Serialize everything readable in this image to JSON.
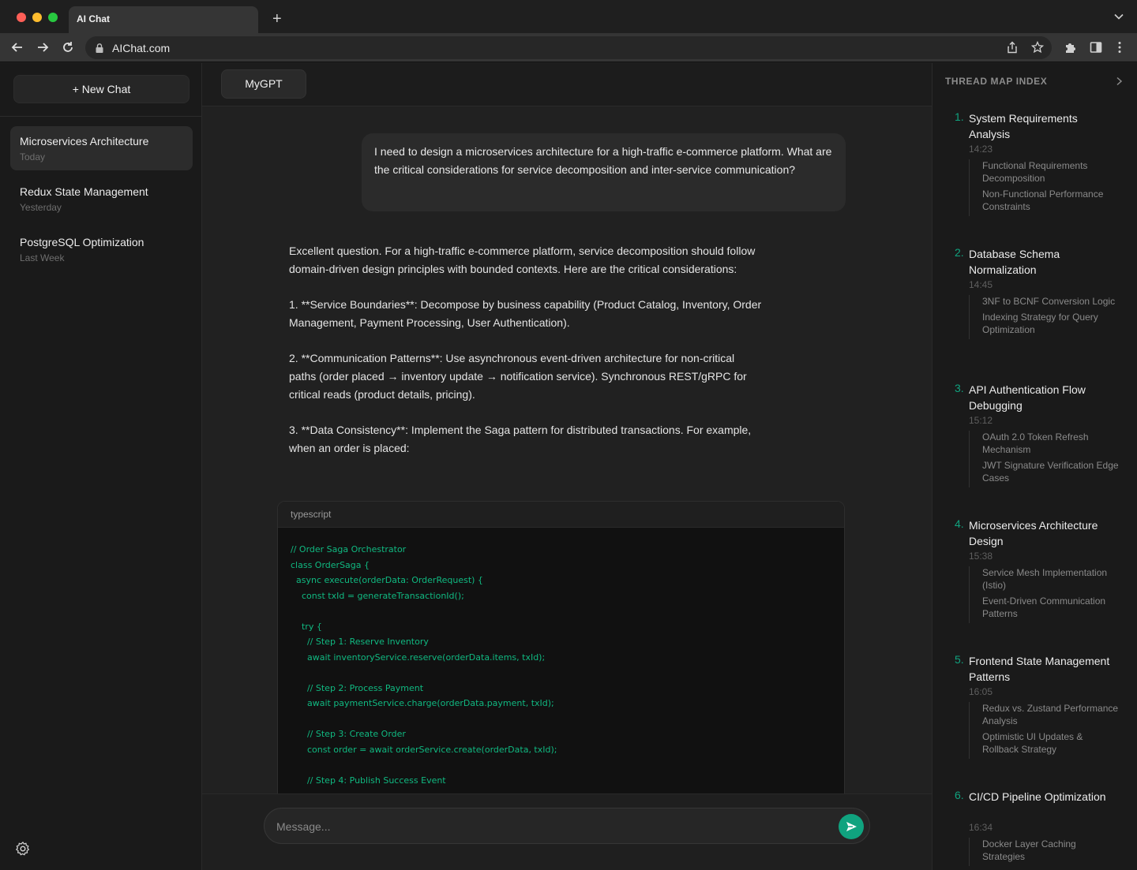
{
  "browser": {
    "tab_title": "AI Chat",
    "new_tab_label": "+",
    "url": "AIChat.com"
  },
  "sidebar": {
    "new_chat_label": "+ New Chat",
    "chats": [
      {
        "title": "Microservices Architecture",
        "date": "Today",
        "active": true
      },
      {
        "title": "Redux State Management",
        "date": "Yesterday",
        "active": false
      },
      {
        "title": "PostgreSQL Optimization",
        "date": "Last Week",
        "active": false
      }
    ]
  },
  "main": {
    "model_label": "MyGPT",
    "user_message": "I need to design a microservices architecture for a high-traffic e-commerce platform. What are the critical considerations for service decomposition and inter-service communication?",
    "assistant_paragraphs": [
      "Excellent question. For a high-traffic e-commerce platform, service decomposition should follow domain-driven design principles with bounded contexts. Here are the critical considerations:",
      "1. **Service Boundaries**: Decompose by business capability (Product Catalog, Inventory, Order Management, Payment Processing, User Authentication).",
      "2. **Communication Patterns**: Use asynchronous event-driven architecture for non-critical paths (order placed → inventory update → notification service). Synchronous REST/gRPC for critical reads (product details, pricing).",
      "3. **Data Consistency**: Implement the Saga pattern for distributed transactions. For example, when an order is placed:"
    ],
    "code": {
      "language": "typescript",
      "lines": [
        "// Order Saga Orchestrator",
        "class OrderSaga {",
        "  async execute(orderData: OrderRequest) {",
        "    const txId = generateTransactionId();",
        "",
        "    try {",
        "      // Step 1: Reserve Inventory",
        "      await inventoryService.reserve(orderData.items, txId);",
        "",
        "      // Step 2: Process Payment",
        "      await paymentService.charge(orderData.payment, txId);",
        "",
        "      // Step 3: Create Order",
        "      const order = await orderService.create(orderData, txId);",
        "",
        "      // Step 4: Publish Success Event"
      ]
    },
    "composer_placeholder": "Message..."
  },
  "thread_map": {
    "title": "THREAD MAP INDEX",
    "sections": [
      {
        "num": "1.",
        "title": "System Requirements Analysis",
        "time": "14:23",
        "subs": [
          "Functional Requirements Decomposition",
          "Non-Functional Performance Constraints"
        ]
      },
      {
        "num": "2.",
        "title": "Database Schema Normalization",
        "time": "14:45",
        "subs": [
          "3NF to BCNF Conversion Logic",
          "Indexing Strategy for Query Optimization"
        ]
      },
      {
        "num": "3.",
        "title": "API Authentication Flow Debugging",
        "time": "15:12",
        "subs": [
          "OAuth 2.0 Token Refresh Mechanism",
          "JWT Signature Verification Edge Cases"
        ]
      },
      {
        "num": "4.",
        "title": "Microservices Architecture Design",
        "time": "15:38",
        "subs": [
          "Service Mesh Implementation (Istio)",
          "Event-Driven Communication Patterns"
        ]
      },
      {
        "num": "5.",
        "title": "Frontend State Management Patterns",
        "time": "16:05",
        "subs": [
          "Redux vs. Zustand Performance Analysis",
          "Optimistic UI Updates & Rollback Strategy"
        ]
      },
      {
        "num": "6.",
        "title": "CI/CD Pipeline Optimization",
        "time": "16:34",
        "subs": [
          "Docker Layer Caching Strategies"
        ]
      }
    ]
  },
  "colors": {
    "accent": "#10a37f",
    "code_text": "#10b981"
  }
}
